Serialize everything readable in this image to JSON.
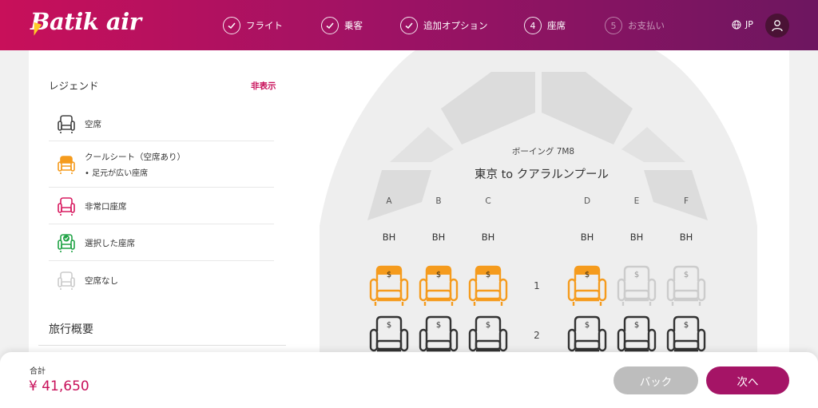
{
  "brand": {
    "logo_text": "Batik air",
    "color": "#c8105a"
  },
  "steps": [
    {
      "label": "フライト",
      "status": "done",
      "marker": ""
    },
    {
      "label": "乗客",
      "status": "done",
      "marker": ""
    },
    {
      "label": "追加オプション",
      "status": "done",
      "marker": ""
    },
    {
      "label": "座席",
      "status": "current",
      "marker": "4"
    },
    {
      "label": "お支払い",
      "status": "upcoming",
      "marker": "5"
    }
  ],
  "header": {
    "language": "JP",
    "globe_icon": "globe-icon",
    "user_icon": "user-icon"
  },
  "legend": {
    "title": "レジェンド",
    "hide_label": "非表示",
    "items": [
      {
        "label": "空席",
        "icon": "available-seat-icon",
        "color": "#444444"
      },
      {
        "label": "クールシート（空席あり）",
        "sub": "• 足元が広い座席",
        "icon": "cool-seat-icon",
        "color": "#f59b1d"
      },
      {
        "label": "非常口座席",
        "icon": "exit-seat-icon",
        "color": "#d81b60"
      },
      {
        "label": "選択した座席",
        "icon": "selected-seat-icon",
        "color": "#22a447"
      },
      {
        "label": "空席なし",
        "icon": "unavailable-seat-icon",
        "color": "#cccccc"
      }
    ]
  },
  "trip": {
    "title": "旅行概要"
  },
  "seatmap": {
    "aircraft": "ボーイング 7M8",
    "route": "東京 to クアラルンプール",
    "columns": [
      "A",
      "B",
      "C",
      "D",
      "E",
      "F"
    ],
    "bh_labels": [
      "BH",
      "BH",
      "BH",
      "BH",
      "BH",
      "BH"
    ],
    "price_symbol": "$",
    "rows": [
      {
        "number": "1",
        "seats": [
          "cool",
          "cool",
          "cool",
          "cool",
          "unavailable",
          "unavailable"
        ]
      },
      {
        "number": "2",
        "seats": [
          "available",
          "available",
          "available",
          "available",
          "available",
          "available"
        ]
      }
    ]
  },
  "footer": {
    "total_label": "合計",
    "total_value": "¥ 41,650",
    "back_label": "バック",
    "next_label": "次へ"
  }
}
